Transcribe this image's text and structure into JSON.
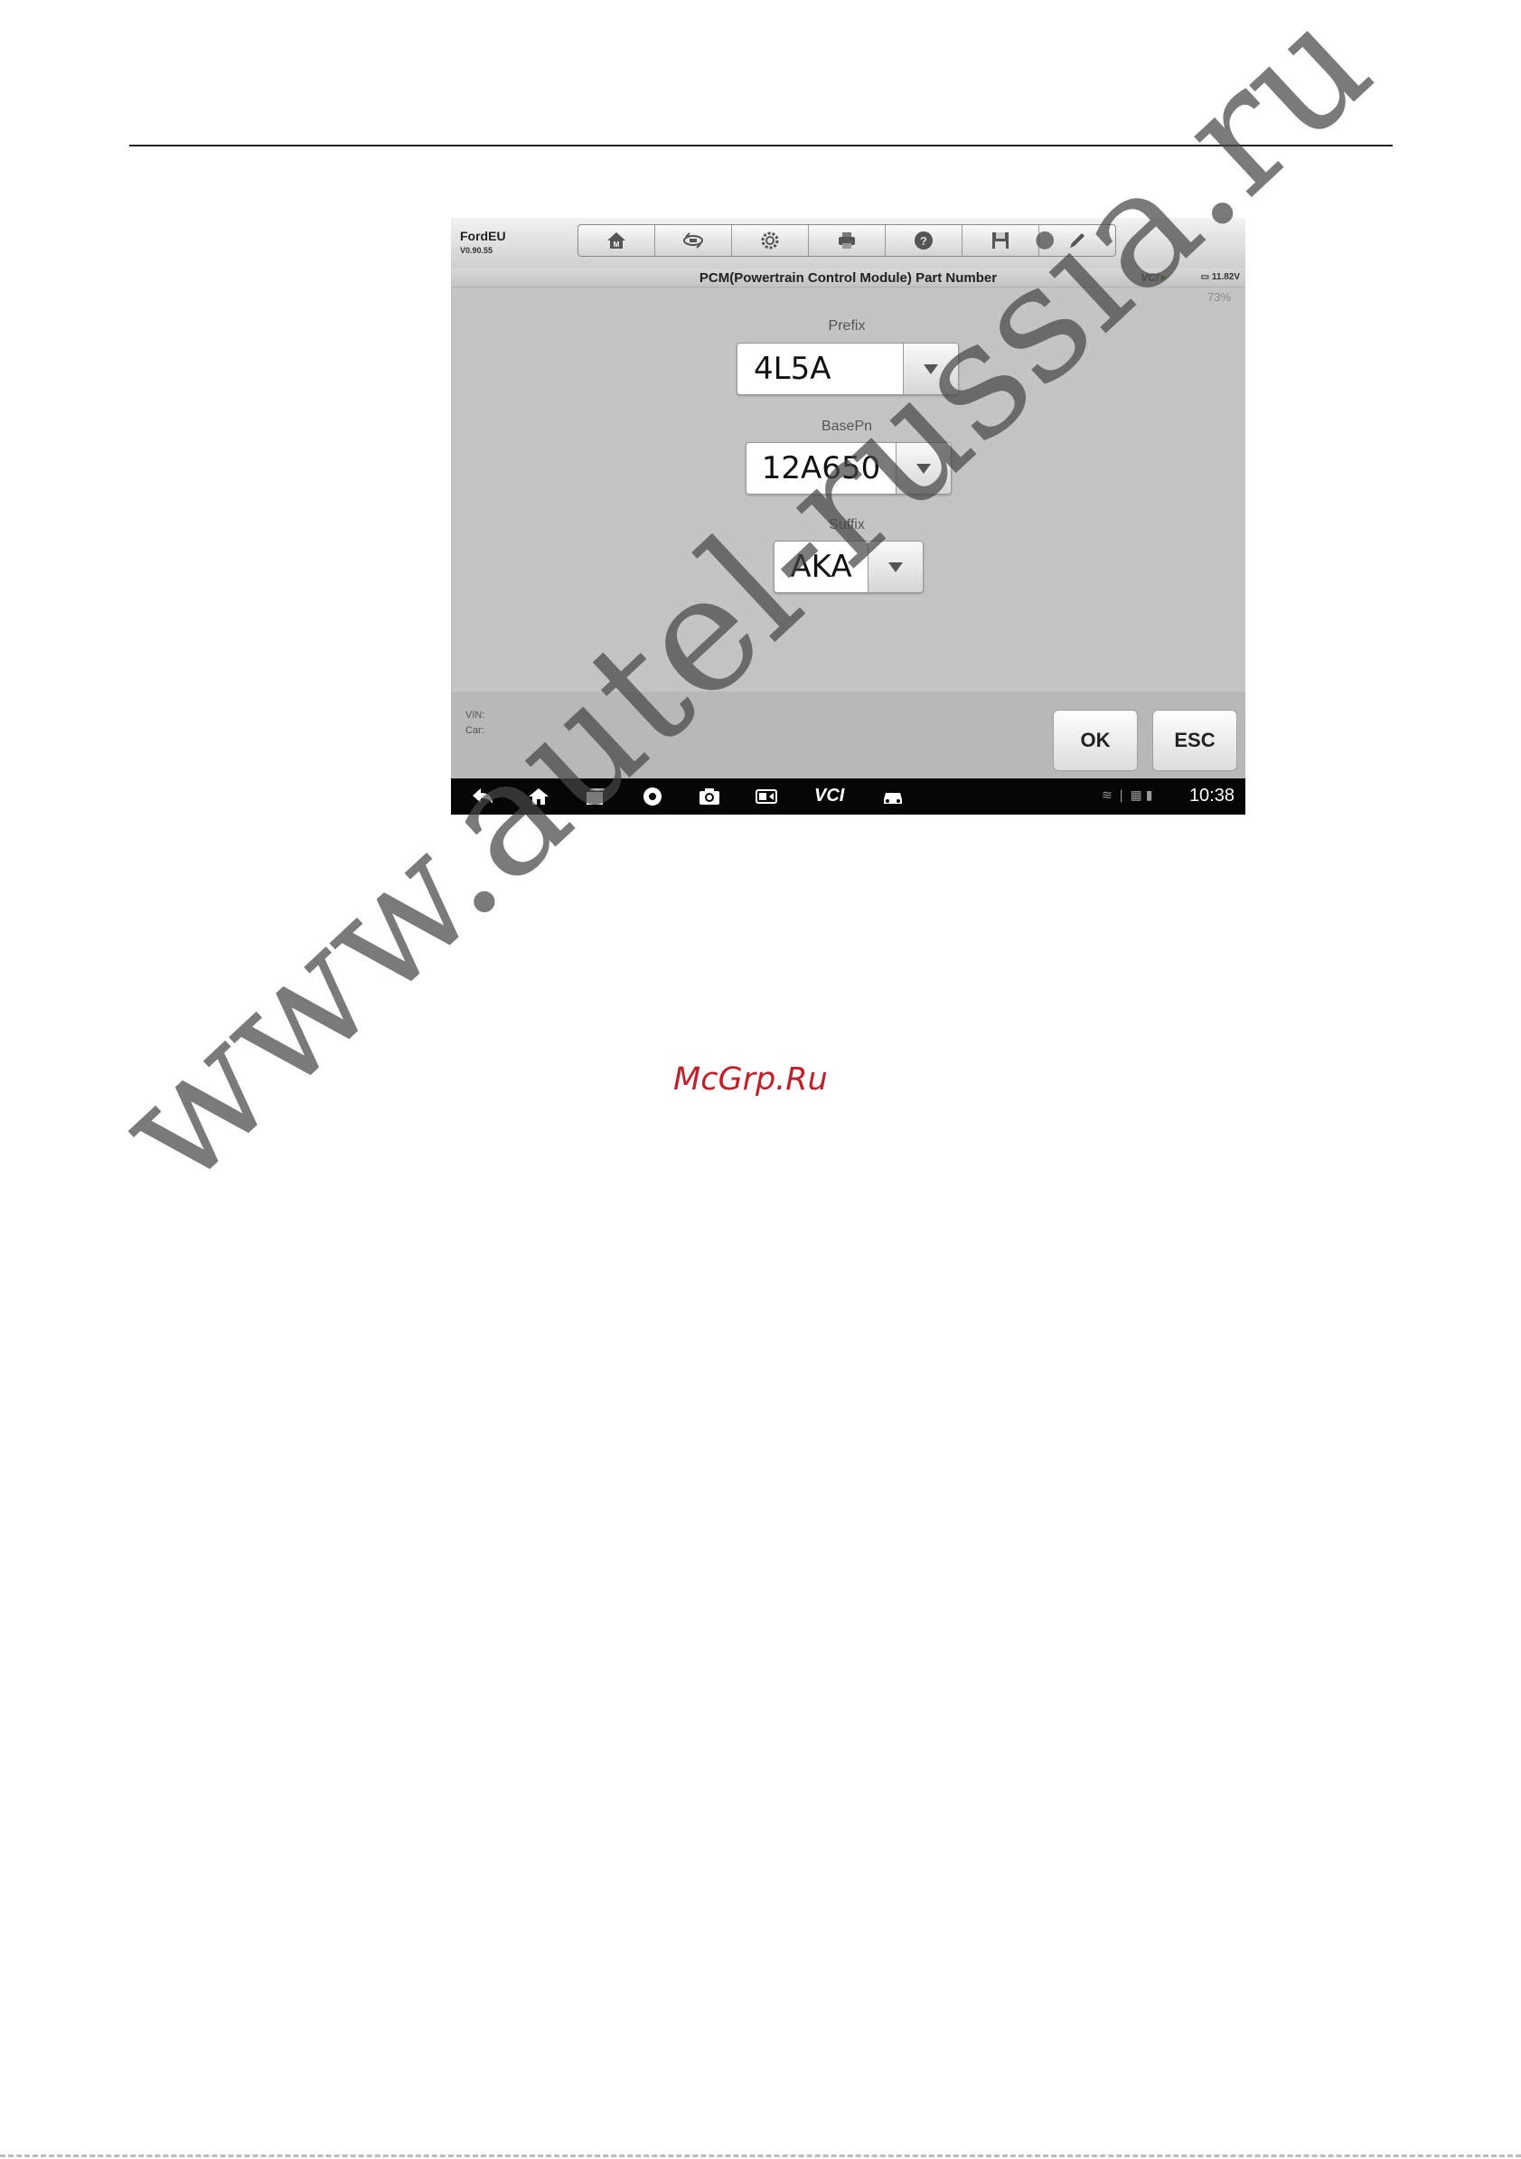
{
  "app": {
    "name": "FordEU",
    "version": "V0.90.55"
  },
  "toolbar": {
    "items": [
      "home-icon",
      "vehicle-swap-icon",
      "settings-icon",
      "print-icon",
      "help-icon",
      "save-icon",
      "pen-icon"
    ]
  },
  "titlebar": {
    "title": "PCM(Powertrain Control Module) Part Number",
    "vci": "VCI",
    "voltage": "11.82V",
    "battery": "73%"
  },
  "fields": [
    {
      "label": "Prefix",
      "value": "4L5A"
    },
    {
      "label": "BasePn",
      "value": "12A650"
    },
    {
      "label": "Suffix",
      "value": "AKA"
    }
  ],
  "footer": {
    "vin_label": "VIN:",
    "car_label": "Car:",
    "ok_label": "OK",
    "esc_label": "ESC"
  },
  "android_bar": {
    "vci_label": "VCI",
    "clock": "10:38"
  },
  "watermark": {
    "text": "www.autel-russia.ru",
    "stamp": "McGrp.Ru"
  }
}
